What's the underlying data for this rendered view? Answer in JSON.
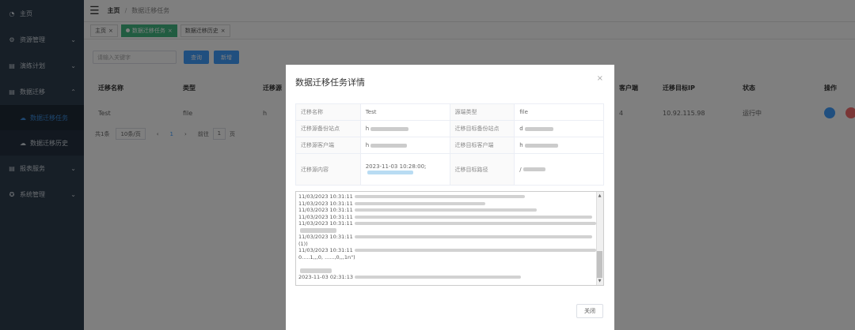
{
  "sidebar": {
    "items": [
      {
        "icon": "dashboard-icon",
        "glyph": "◔",
        "label": "主页"
      },
      {
        "icon": "resource-icon",
        "glyph": "⚙",
        "label": "资源管理"
      },
      {
        "icon": "plan-icon",
        "glyph": "▤",
        "label": "演练计划"
      },
      {
        "icon": "migrate-icon",
        "glyph": "▤",
        "label": "数据迁移"
      },
      {
        "icon": "report-icon",
        "glyph": "▤",
        "label": "报表服务"
      },
      {
        "icon": "system-icon",
        "glyph": "✪",
        "label": "系统管理"
      }
    ],
    "sub_items": [
      {
        "label": "数据迁移任务",
        "active": true
      },
      {
        "label": "数据迁移历史",
        "active": false
      }
    ]
  },
  "header": {
    "breadcrumb_home": "主页",
    "breadcrumb_current": "数据迁移任务"
  },
  "tabs": [
    {
      "label": "主页"
    },
    {
      "label": "数据迁移任务"
    },
    {
      "label": "数据迁移历史"
    }
  ],
  "search": {
    "placeholder": "请输入关键字",
    "query_label": "查询",
    "add_label": "新增"
  },
  "table": {
    "headers": [
      "迁移名称",
      "类型",
      "迁移源",
      "客户端",
      "迁移目标IP",
      "状态",
      "操作"
    ],
    "row": {
      "name": "Test",
      "type": "file",
      "source": "h",
      "client": "4",
      "target_ip": "10.92.115.98",
      "status": "运行中"
    }
  },
  "pager": {
    "total": "共1条",
    "page_size": "10条/页",
    "prev": "‹",
    "current": "1",
    "next": "›",
    "goto_label": "前往",
    "goto_value": "1",
    "page_suffix": "页"
  },
  "modal": {
    "title": "数据迁移任务详情",
    "rows": [
      {
        "l1": "迁移名称",
        "v1": "Test",
        "l2": "源端类型",
        "v2": "file"
      },
      {
        "l1": "迁移源备份站点",
        "v1": "h",
        "l2": "迁移目标备份站点",
        "v2": "d"
      },
      {
        "l1": "迁移源客户端",
        "v1": "h",
        "l2": "迁移目标客户端",
        "v2": "h"
      },
      {
        "l1": "迁移源内容",
        "v1": "2023-11-03 10:28:00;",
        "l2": "迁移目标路径",
        "v2": "/"
      }
    ],
    "log_lines": [
      "11/03/2023 10:31:11",
      "11/03/2023 10:31:11",
      "11/03/2023 10:31:11",
      "11/03/2023 10:31:11",
      "11/03/2023 10:31:11",
      "",
      "11/03/2023 10:31:11",
      "(1))",
      "11/03/2023 10:31:11",
      "0.....1,,,0, ......,0,,,1n\")",
      "",
      "",
      "2023-11-03 02:31:13"
    ],
    "close_label": "关闭",
    "close_glyph": "×"
  }
}
